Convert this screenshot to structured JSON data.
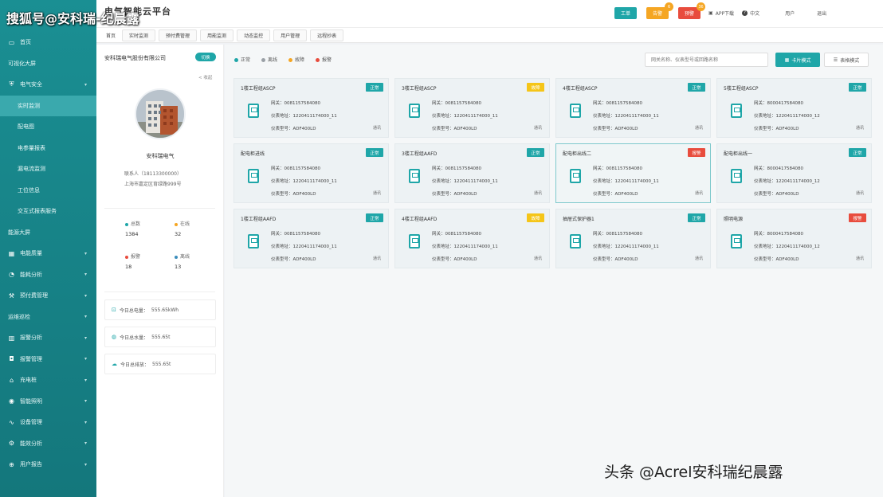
{
  "header": {
    "title": "电气智能云平台",
    "actions": [
      {
        "label": "工单",
        "color": "#1fa6a8",
        "badge": ""
      },
      {
        "label": "告警",
        "color": "#f5a623",
        "badge": "6"
      },
      {
        "label": "预警",
        "color": "#e84c3d",
        "badge": "36"
      }
    ],
    "app_download": "APP下载",
    "language": "中文",
    "user": "用户",
    "logout": "退出"
  },
  "sidebar": {
    "items": [
      {
        "label": "首页",
        "icon": "monitor-icon",
        "sub": false,
        "chevron": false
      },
      {
        "label": "可视化大屏",
        "icon": "",
        "sub": false,
        "chevron": false
      },
      {
        "label": "电气安全",
        "icon": "shield-icon",
        "sub": false,
        "chevron": true
      },
      {
        "label": "实时监测",
        "icon": "",
        "sub": true,
        "chevron": false,
        "active": true
      },
      {
        "label": "配电图",
        "icon": "",
        "sub": true,
        "chevron": false
      },
      {
        "label": "电参量报表",
        "icon": "",
        "sub": true,
        "chevron": false
      },
      {
        "label": "漏电流监测",
        "icon": "",
        "sub": true,
        "chevron": false
      },
      {
        "label": "工位信息",
        "icon": "",
        "sub": true,
        "chevron": false
      },
      {
        "label": "交互式报表服务",
        "icon": "",
        "sub": true,
        "chevron": false
      },
      {
        "label": "能源大屏",
        "icon": "",
        "sub": false,
        "chevron": false
      },
      {
        "label": "电能质量",
        "icon": "grid-icon",
        "sub": false,
        "chevron": true
      },
      {
        "label": "能耗分析",
        "icon": "chart-icon",
        "sub": false,
        "chevron": true
      },
      {
        "label": "预付费管理",
        "icon": "tool-icon",
        "sub": false,
        "chevron": true
      },
      {
        "label": "运维巡检",
        "icon": "",
        "sub": false,
        "chevron": true
      },
      {
        "label": "报警分析",
        "icon": "bar-icon",
        "sub": false,
        "chevron": true
      },
      {
        "label": "报警管理",
        "icon": "bell-icon",
        "sub": false,
        "chevron": true
      },
      {
        "label": "充电桩",
        "icon": "plug-icon",
        "sub": false,
        "chevron": true
      },
      {
        "label": "智能照明",
        "icon": "pin-icon",
        "sub": false,
        "chevron": true
      },
      {
        "label": "设备管理",
        "icon": "wave-icon",
        "sub": false,
        "chevron": true
      },
      {
        "label": "能效分析",
        "icon": "gear-icon",
        "sub": false,
        "chevron": true
      },
      {
        "label": "用户报告",
        "icon": "plus-icon",
        "sub": false,
        "chevron": true
      }
    ]
  },
  "tabs": [
    {
      "label": "首页",
      "plain": true
    },
    {
      "label": "实时监测",
      "plain": false
    },
    {
      "label": "预付费管理",
      "plain": false
    },
    {
      "label": "用能监测",
      "plain": false
    },
    {
      "label": "动态监控",
      "plain": false
    },
    {
      "label": "用户管理",
      "plain": false
    },
    {
      "label": "远程抄表",
      "plain": false
    }
  ],
  "info": {
    "company": "安科瑞电气股份有限公司",
    "switch_label": "切换",
    "collapse": "< 收起",
    "station_name": "安科瑞电气",
    "contact_person": "联系人（18113300000）",
    "address": "上海市嘉定区育绿路999号",
    "stats": [
      {
        "label": "总数",
        "value": "1384",
        "color": "#1fa6a8"
      },
      {
        "label": "在线",
        "value": "32",
        "color": "#f5a623"
      },
      {
        "label": "报警",
        "value": "18",
        "color": "#e84c3d"
      },
      {
        "label": "离线",
        "value": "13",
        "color": "#3c8dbc"
      }
    ],
    "energy": [
      {
        "label": "今日总电量：",
        "value": "555.65kWh"
      },
      {
        "label": "今日总水量：",
        "value": "555.65t"
      },
      {
        "label": "今日总排放：",
        "value": "555.65t"
      }
    ]
  },
  "main": {
    "legend": [
      {
        "label": "正常",
        "color": "#1fa6a8"
      },
      {
        "label": "离线",
        "color": "#9aa0a6"
      },
      {
        "label": "故障",
        "color": "#f5a623"
      },
      {
        "label": "报警",
        "color": "#e84c3d"
      }
    ],
    "search_placeholder": "网关名称、仪表型号或回路名称",
    "view_primary": "卡片模式",
    "view_secondary": "表格模式",
    "field_labels": {
      "gateway": "网关：",
      "address": "仪表地址：",
      "model": "仪表型号："
    },
    "cards": [
      {
        "title": "1楼工程组ASCP",
        "status": "正常",
        "status_color": "#1fa6a8",
        "gateway": "0081157584080",
        "address": "1220411174000_11",
        "model": "ADF400LD",
        "comm": "通讯",
        "selected": false
      },
      {
        "title": "3楼工程组ASCP",
        "status": "故障",
        "status_color": "#f5c518",
        "gateway": "0081157584080",
        "address": "1220411174000_11",
        "model": "ADF400LD",
        "comm": "通讯",
        "selected": false
      },
      {
        "title": "4楼工程组ASCP",
        "status": "正常",
        "status_color": "#1fa6a8",
        "gateway": "0081157584080",
        "address": "1220411174000_11",
        "model": "ADF400LD",
        "comm": "通讯",
        "selected": false
      },
      {
        "title": "5楼工程组ASCP",
        "status": "正常",
        "status_color": "#1fa6a8",
        "gateway": "8000417584080",
        "address": "1220411174000_12",
        "model": "ADF400LD",
        "comm": "通讯",
        "selected": false
      },
      {
        "title": "配电柜进线",
        "status": "正常",
        "status_color": "#1fa6a8",
        "gateway": "0081157584080",
        "address": "1220411174000_11",
        "model": "ADF400LD",
        "comm": "通讯",
        "selected": false
      },
      {
        "title": "3楼工程组AAFD",
        "status": "正常",
        "status_color": "#1fa6a8",
        "gateway": "0081157584080",
        "address": "1220411174000_11",
        "model": "ADF400LD",
        "comm": "通讯",
        "selected": false
      },
      {
        "title": "配电柜出线二",
        "status": "报警",
        "status_color": "#e84c3d",
        "gateway": "0081157584080",
        "address": "1220411174000_11",
        "model": "ADF400LD",
        "comm": "通讯",
        "selected": true
      },
      {
        "title": "配电柜出线一",
        "status": "正常",
        "status_color": "#1fa6a8",
        "gateway": "8000417584080",
        "address": "1220411174000_12",
        "model": "ADF400LD",
        "comm": "通讯",
        "selected": false
      },
      {
        "title": "1楼工程组AAFD",
        "status": "正常",
        "status_color": "#1fa6a8",
        "gateway": "0081157584080",
        "address": "1220411174000_11",
        "model": "ADF400LD",
        "comm": "通讯",
        "selected": false
      },
      {
        "title": "4楼工程组AAFD",
        "status": "故障",
        "status_color": "#f5c518",
        "gateway": "0081157584080",
        "address": "1220411174000_11",
        "model": "ADF400LD",
        "comm": "通讯",
        "selected": false
      },
      {
        "title": "抽屉式保护器1",
        "status": "正常",
        "status_color": "#1fa6a8",
        "gateway": "0081157584080",
        "address": "1220411174000_11",
        "model": "ADF400LD",
        "comm": "通讯",
        "selected": false
      },
      {
        "title": "照明电源",
        "status": "报警",
        "status_color": "#e84c3d",
        "gateway": "8000417584080",
        "address": "1220411174000_12",
        "model": "ADF400LD",
        "comm": "通讯",
        "selected": false
      }
    ]
  },
  "watermarks": {
    "top": "搜狐号@安科瑞-纪晨露",
    "bottom": "头条 @Acrel安科瑞纪晨露"
  }
}
